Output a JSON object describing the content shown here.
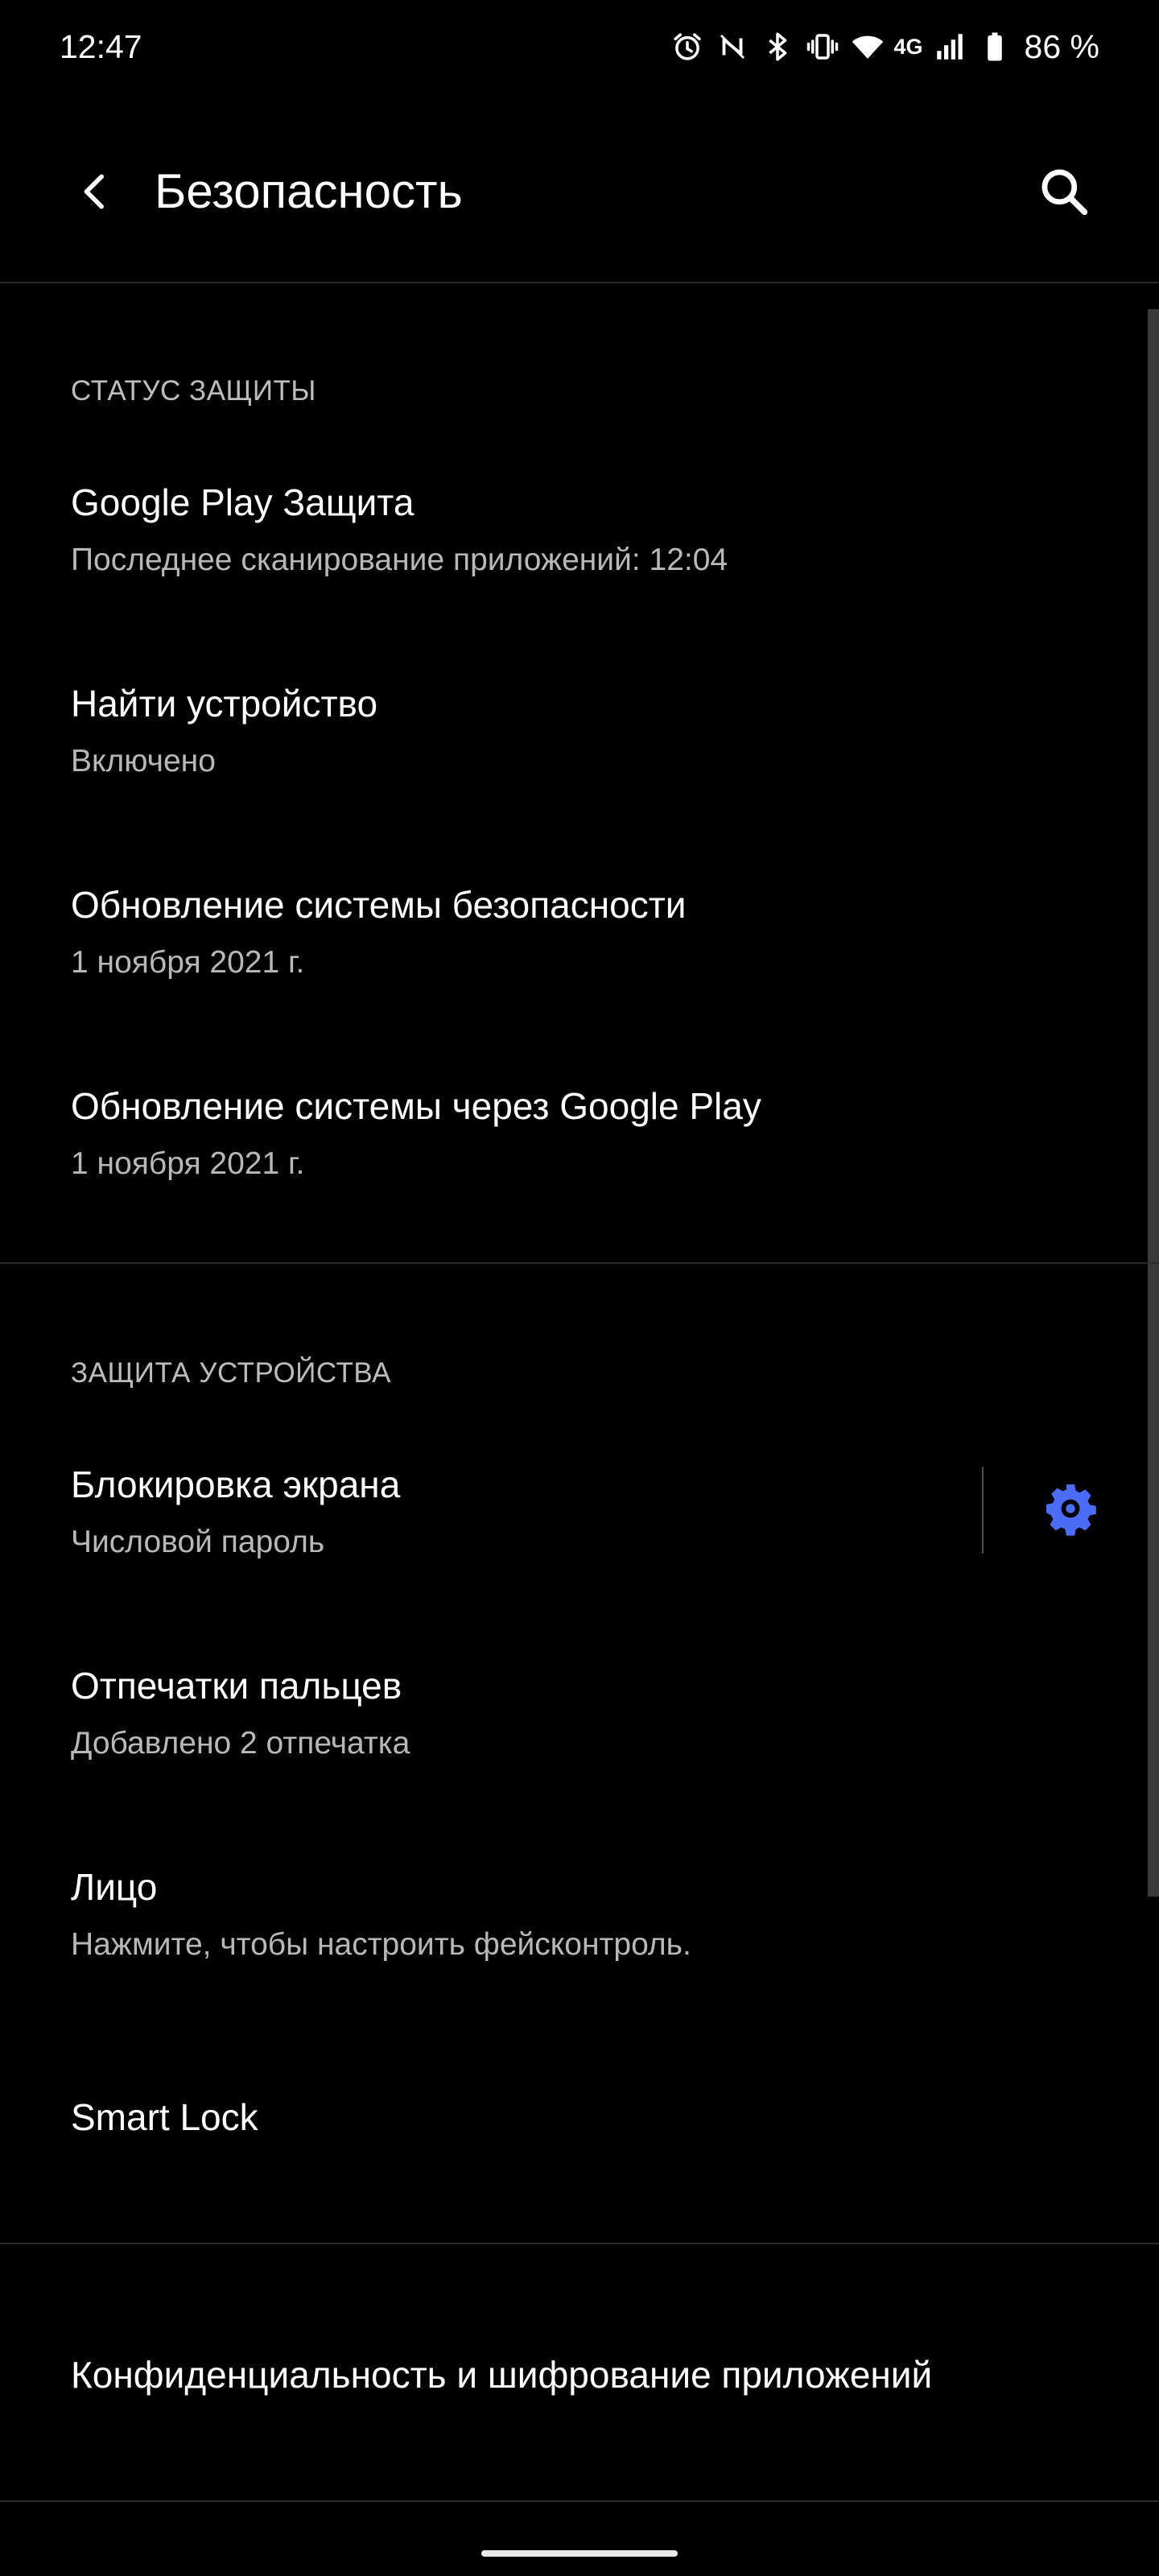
{
  "status_bar": {
    "time": "12:47",
    "network_type": "4G",
    "battery": "86 %",
    "icons": [
      "alarm-icon",
      "nfc-icon",
      "bluetooth-icon",
      "vibrate-icon",
      "wifi-icon",
      "signal-icon",
      "battery-icon"
    ]
  },
  "app_bar": {
    "title": "Безопасность",
    "back_icon": "back-arrow-icon",
    "search_icon": "search-icon"
  },
  "sections": {
    "protection_status": {
      "header": "СТАТУС ЗАЩИТЫ",
      "items": [
        {
          "title": "Google Play Защита",
          "subtitle": "Последнее сканирование приложений: 12:04"
        },
        {
          "title": "Найти устройство",
          "subtitle": "Включено"
        },
        {
          "title": "Обновление системы безопасности",
          "subtitle": "1 ноября 2021 г."
        },
        {
          "title": "Обновление системы через Google Play",
          "subtitle": "1 ноября 2021 г."
        }
      ]
    },
    "device_protection": {
      "header": "ЗАЩИТА УСТРОЙСТВА",
      "items": [
        {
          "title": "Блокировка экрана",
          "subtitle": "Числовой пароль",
          "action_icon": "gear-icon"
        },
        {
          "title": "Отпечатки пальцев",
          "subtitle": "Добавлено 2 отпечатка"
        },
        {
          "title": "Лицо",
          "subtitle": "Нажмите, чтобы настроить фейсконтроль."
        },
        {
          "title": "Smart Lock"
        }
      ]
    },
    "other": {
      "items": [
        {
          "title": "Конфиденциальность и шифрование приложений"
        }
      ]
    }
  },
  "colors": {
    "background": "#000000",
    "primary_text": "#ffffff",
    "secondary_text": "#b8b8b8",
    "accent": "#4a6cf7",
    "divider": "#2a2a2a"
  }
}
